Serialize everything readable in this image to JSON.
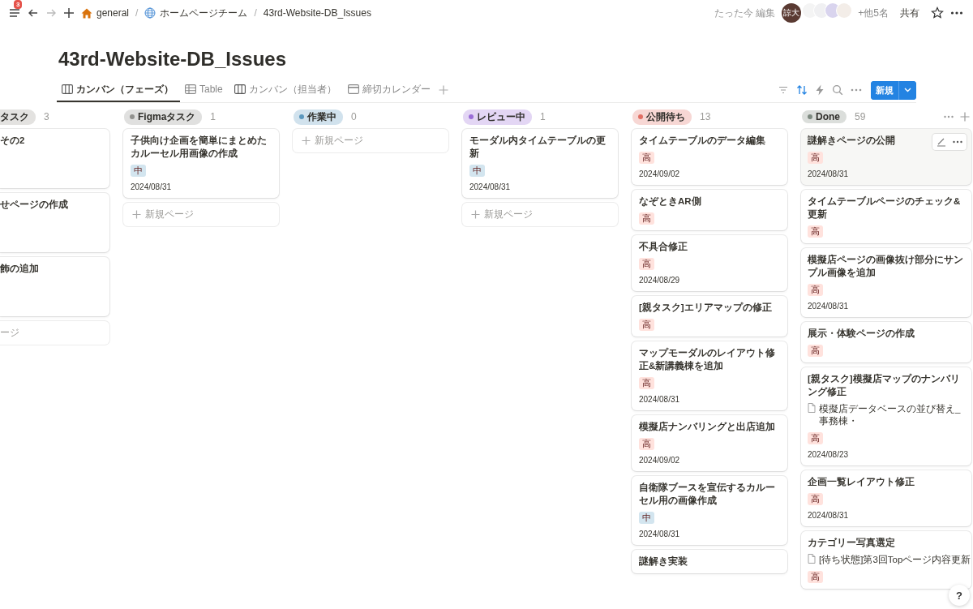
{
  "topbar": {
    "notification_count": "3",
    "breadcrumbs": [
      {
        "kind": "home",
        "label": "general"
      },
      {
        "kind": "separator",
        "label": "/"
      },
      {
        "kind": "team",
        "label": "ホームページチーム"
      },
      {
        "kind": "separator",
        "label": "/"
      },
      {
        "kind": "page",
        "label": "43rd-Website-DB_Issues"
      }
    ],
    "edited": "たった今 編集",
    "avatars": [
      {
        "label": "諒大",
        "color": "#5a3a32"
      },
      {
        "color": "#f4f4f4"
      },
      {
        "color": "#f0f0f2"
      },
      {
        "color": "#d9d4ee"
      },
      {
        "color": "#f3ede8"
      }
    ],
    "more_people": "+他5名",
    "share": "共有"
  },
  "title": "43rd-Website-DB_Issues",
  "views": [
    {
      "label": "カンバン（フェーズ）",
      "kind": "board",
      "selected": true
    },
    {
      "label": "Table",
      "kind": "table",
      "selected": false
    },
    {
      "label": "カンバン（担当者）",
      "kind": "board",
      "selected": false
    },
    {
      "label": "締切カレンダー",
      "kind": "calendar",
      "selected": false
    }
  ],
  "toolbar": {
    "sort_active": true,
    "new_button": "新規"
  },
  "columns": [
    {
      "name": "タスク",
      "count": "3",
      "clipped": true,
      "cards": [
        {
          "title": "その2",
          "hovered": false
        },
        {
          "title": "せページの作成",
          "hovered": false
        },
        {
          "title": "飾の追加",
          "hovered": false
        }
      ],
      "new_page": "ージ"
    },
    {
      "name": "Figmaタスク",
      "count": "1",
      "color": "#91918e",
      "clipped": false,
      "cards": [
        {
          "title": "子供向け企画を簡単にまとめたカルーセル用画像の作成",
          "tag": {
            "label": "中",
            "color": "#d3e5ef"
          },
          "date": "2024/08/31",
          "hovered": false
        }
      ],
      "new_page": "新規ページ"
    },
    {
      "name": "作業中",
      "count": "0",
      "color": "#5b97bd",
      "clipped": false,
      "new_page": "新規ページ"
    },
    {
      "name": "レビュー中",
      "count": "1",
      "color": "#9a6dd7",
      "clipped": false,
      "cards": [
        {
          "title": "モーダル内タイムテーブルの更新",
          "tag": {
            "label": "中",
            "color": "#d3e5ef"
          },
          "date": "2024/08/31",
          "hovered": false
        }
      ],
      "new_page": "新規ページ"
    },
    {
      "name": "公開待ち",
      "count": "13",
      "color": "#e16f64",
      "clipped": false,
      "cards": [
        {
          "title": "タイムテーブルのデータ編集",
          "tag": {
            "label": "高",
            "color": "#ffe2dd"
          },
          "date": "2024/09/02",
          "hovered": false
        },
        {
          "title": "なぞときAR側",
          "tag": {
            "label": "高",
            "color": "#ffe2dd"
          },
          "hovered": false
        },
        {
          "title": "不具合修正",
          "tag": {
            "label": "高",
            "color": "#ffe2dd"
          },
          "date": "2024/08/29",
          "hovered": false
        },
        {
          "title": "[親タスク]エリアマップの修正",
          "tag": {
            "label": "高",
            "color": "#ffe2dd"
          },
          "hovered": false
        },
        {
          "title": "マップモーダルのレイアウト修正&新講義棟を追加",
          "tag": {
            "label": "高",
            "color": "#ffe2dd"
          },
          "date": "2024/08/31",
          "hovered": false
        },
        {
          "title": "模擬店ナンバリングと出店追加",
          "tag": {
            "label": "高",
            "color": "#ffe2dd"
          },
          "date": "2024/09/02",
          "hovered": false
        },
        {
          "title": "自衛隊ブースを宣伝するカルーセル用の画像作成",
          "tag": {
            "label": "中",
            "color": "#d3e5ef"
          },
          "date": "2024/08/31",
          "hovered": false
        },
        {
          "title": "謎解き実装",
          "hovered": false
        }
      ]
    },
    {
      "name": "Done",
      "count": "59",
      "color": "#7d8a80",
      "clipped": false,
      "cards": [
        {
          "title": "謎解きページの公開",
          "tag": {
            "label": "高",
            "color": "#ffe2dd"
          },
          "date": "2024/08/31",
          "hovered": true
        },
        {
          "title": "タイムテーブルページのチェック&更新",
          "tag": {
            "label": "高",
            "color": "#ffe2dd"
          },
          "hovered": false
        },
        {
          "title": "模擬店ページの画像抜け部分にサンプル画像を追加",
          "tag": {
            "label": "高",
            "color": "#ffe2dd"
          },
          "date": "2024/08/31",
          "hovered": false
        },
        {
          "title": "展示・体験ページの作成",
          "tag": {
            "label": "高",
            "color": "#ffe2dd"
          },
          "hovered": false
        },
        {
          "title": "[親タスク]模擬店マップのナンバリング修正",
          "link": "模擬店データベースの並び替え_事務棟・",
          "tag": {
            "label": "高",
            "color": "#ffe2dd"
          },
          "date": "2024/08/23",
          "hovered": false
        },
        {
          "title": "企画一覧レイアウト修正",
          "tag": {
            "label": "高",
            "color": "#ffe2dd"
          },
          "date": "2024/08/31",
          "hovered": false
        },
        {
          "title": "カテゴリー写真選定",
          "link": "[待ち状態]第3回Topページ内容更新",
          "tag": {
            "label": "高",
            "color": "#ffe2dd"
          },
          "hovered": false
        }
      ]
    }
  ],
  "help_button": "?"
}
